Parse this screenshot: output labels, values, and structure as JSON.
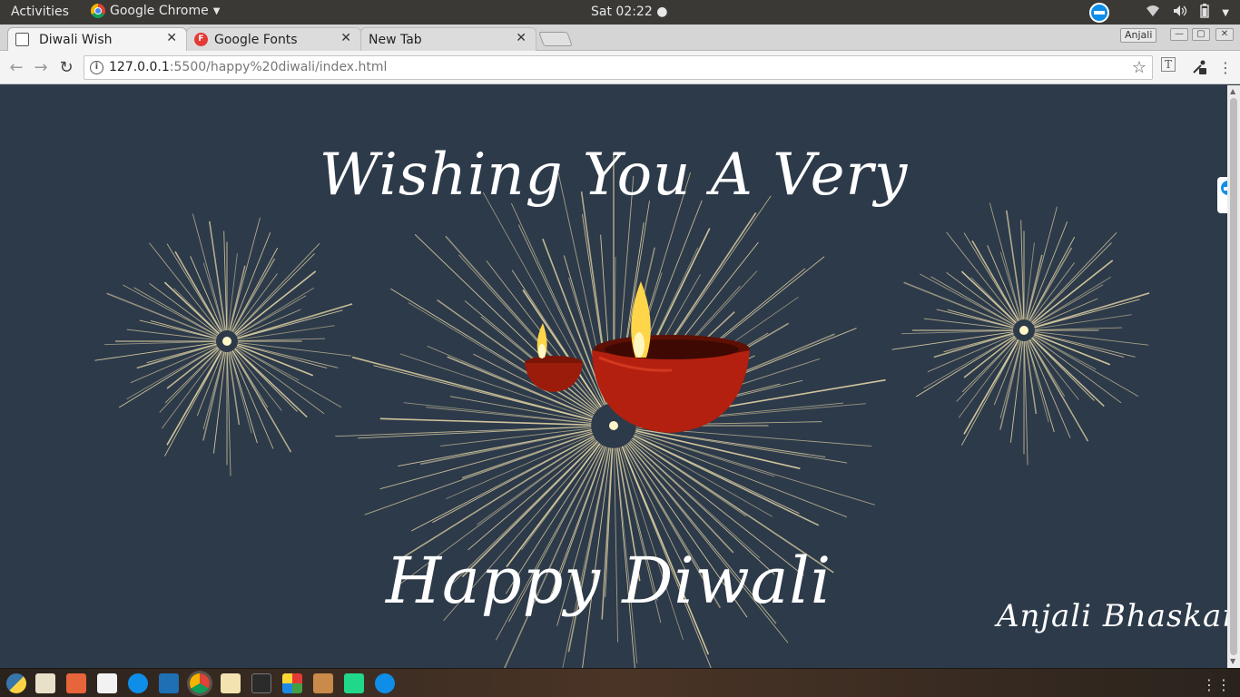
{
  "topbar": {
    "activities": "Activities",
    "app_name": "Google Chrome",
    "clock": "Sat 02:22 ●"
  },
  "tabs": [
    {
      "title": "Diwali Wish",
      "active": true,
      "icon": "page-icon"
    },
    {
      "title": "Google Fonts",
      "active": false,
      "icon": "google-fonts-icon",
      "icon_letter": "F"
    },
    {
      "title": "New Tab",
      "active": false,
      "icon": "none"
    }
  ],
  "window": {
    "profile": "Anjali"
  },
  "address_bar": {
    "host": "127.0.0.1",
    "path": ":5500/happy%20diwali/index.html"
  },
  "page": {
    "heading": "Wishing You A Very",
    "greeting": "Happy Diwali",
    "author": "Anjali Bhaskar",
    "background_color": "#2d3a4a",
    "text_color": "#ffffff",
    "firework_color": "#e8d9a8",
    "diya_color": "#b3200f",
    "flame_color": "#ffd54a"
  },
  "dock": {
    "apps": [
      "python-icon",
      "gimp-icon",
      "files-icon",
      "text-editor-icon",
      "teamviewer-icon",
      "vscode-icon",
      "chrome-icon",
      "notes-icon",
      "terminal-icon",
      "colors-icon",
      "archive-icon",
      "pycharm-icon",
      "teamviewer-icon"
    ]
  }
}
